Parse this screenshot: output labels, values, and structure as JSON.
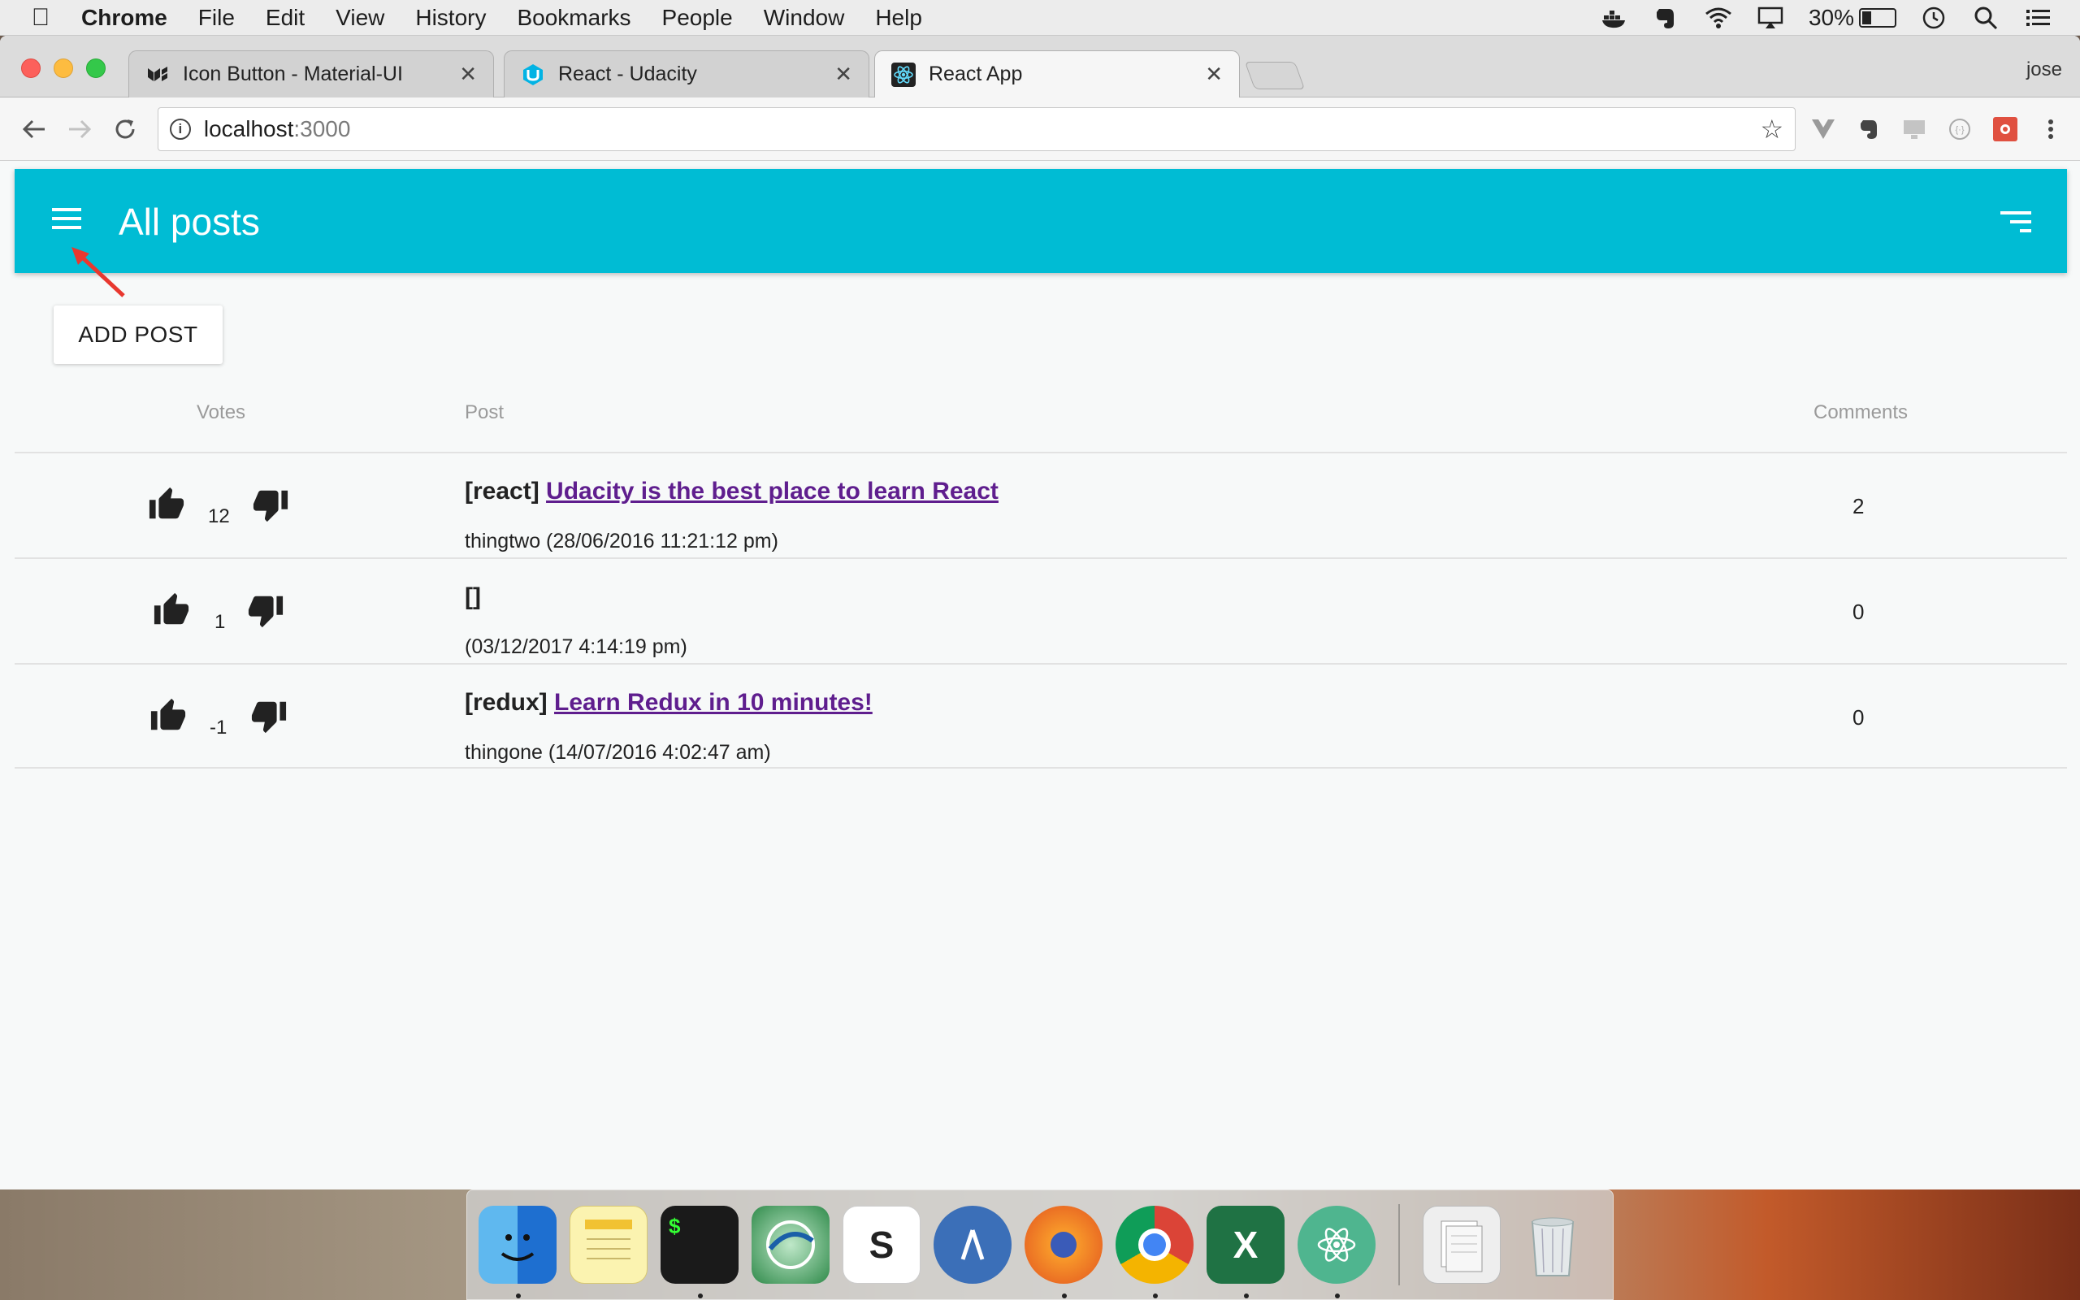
{
  "menubar": {
    "app_name": "Chrome",
    "items": [
      "File",
      "Edit",
      "View",
      "History",
      "Bookmarks",
      "People",
      "Window",
      "Help"
    ],
    "battery_percent": "30%",
    "battery_level": 0.3
  },
  "browser": {
    "tabs": [
      {
        "label": "Icon Button - Material-UI",
        "icon": "material-ui-icon"
      },
      {
        "label": "React - Udacity",
        "icon": "udacity-icon"
      },
      {
        "label": "React App",
        "icon": "react-icon"
      }
    ],
    "active_tab": 2,
    "profile_name": "jose",
    "url_host": "localhost",
    "url_port": ":3000"
  },
  "app": {
    "title": "All posts",
    "add_post_label": "ADD POST",
    "columns": {
      "votes": "Votes",
      "post": "Post",
      "comments": "Comments"
    },
    "posts": [
      {
        "votes": "12",
        "category": "[react]",
        "title": "Udacity is the best place to learn React",
        "meta": "thingtwo (28/06/2016 11:21:12 pm)",
        "comments": "2"
      },
      {
        "votes": "1",
        "category": "[]",
        "title": "",
        "meta": "(03/12/2017 4:14:19 pm)",
        "comments": "0"
      },
      {
        "votes": "-1",
        "category": "[redux]",
        "title": "Learn Redux in 10 minutes!",
        "meta": "thingone (14/07/2016 4:02:47 am)",
        "comments": "0"
      }
    ],
    "accent_color": "#00bcd4",
    "link_color": "#5f1e8e"
  },
  "dock": {
    "items": [
      "finder-icon",
      "notes-icon",
      "terminal-icon",
      "network-icon",
      "slack-icon",
      "xamarin-icon",
      "firefox-icon",
      "chrome-icon",
      "excel-icon",
      "atom-icon",
      "documents-icon",
      "trash-icon"
    ],
    "terminal_text": "$"
  }
}
